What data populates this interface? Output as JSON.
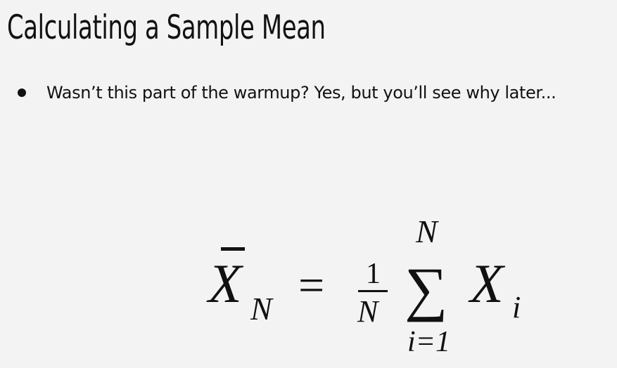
{
  "slide": {
    "title": "Calculating a Sample Mean",
    "bullets": [
      "Wasn’t this part of the warmup? Yes, but you’ll see why later..."
    ]
  },
  "formula": {
    "lhs_symbol": "X",
    "lhs_subscript": "N",
    "equals": "=",
    "frac_numerator": "1",
    "frac_denominator": "N",
    "sum_symbol": "∑",
    "sum_upper": "N",
    "sum_lower": "i=1",
    "term_symbol": "X",
    "term_subscript": "i"
  }
}
